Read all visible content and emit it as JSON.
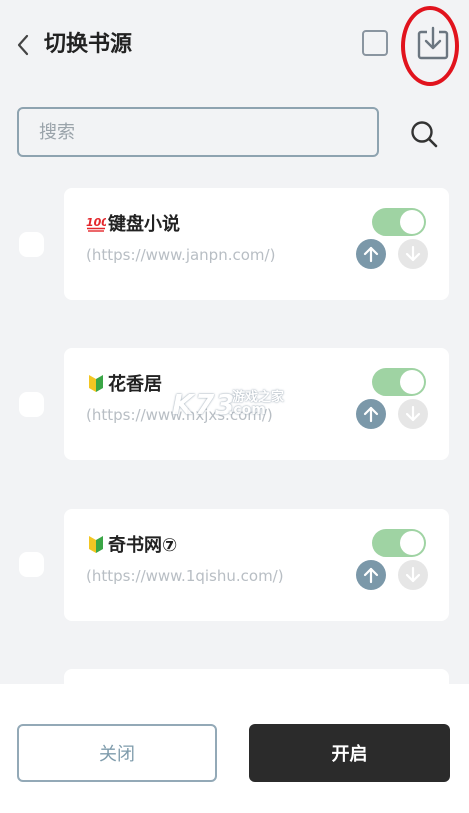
{
  "header": {
    "title": "切换书源",
    "back_icon": "chevron-left-icon",
    "import_icon": "download-tray-icon"
  },
  "search": {
    "placeholder": "搜索",
    "value": ""
  },
  "sources": [
    {
      "badge": "💯",
      "name": "键盘小说",
      "url": "(https://www.janpn.com/)",
      "enabled": true
    },
    {
      "badge": "🔰",
      "name": "花香居",
      "url": "(https://www.hxjxs.com/)",
      "enabled": true
    },
    {
      "badge": "🔰",
      "name": "奇书网⑦",
      "url": "(https://www.1qishu.com/)",
      "enabled": true
    }
  ],
  "footer": {
    "close_label": "关闭",
    "open_label": "开启"
  },
  "watermark": {
    "brand": "K73",
    "site_cn": "游戏之家",
    "domain": ".com"
  },
  "colors": {
    "toggle_on": "#9fd3a3",
    "up_button": "#7b98a9",
    "primary_button": "#2b2b2b",
    "highlight_ring": "#e1131d"
  }
}
